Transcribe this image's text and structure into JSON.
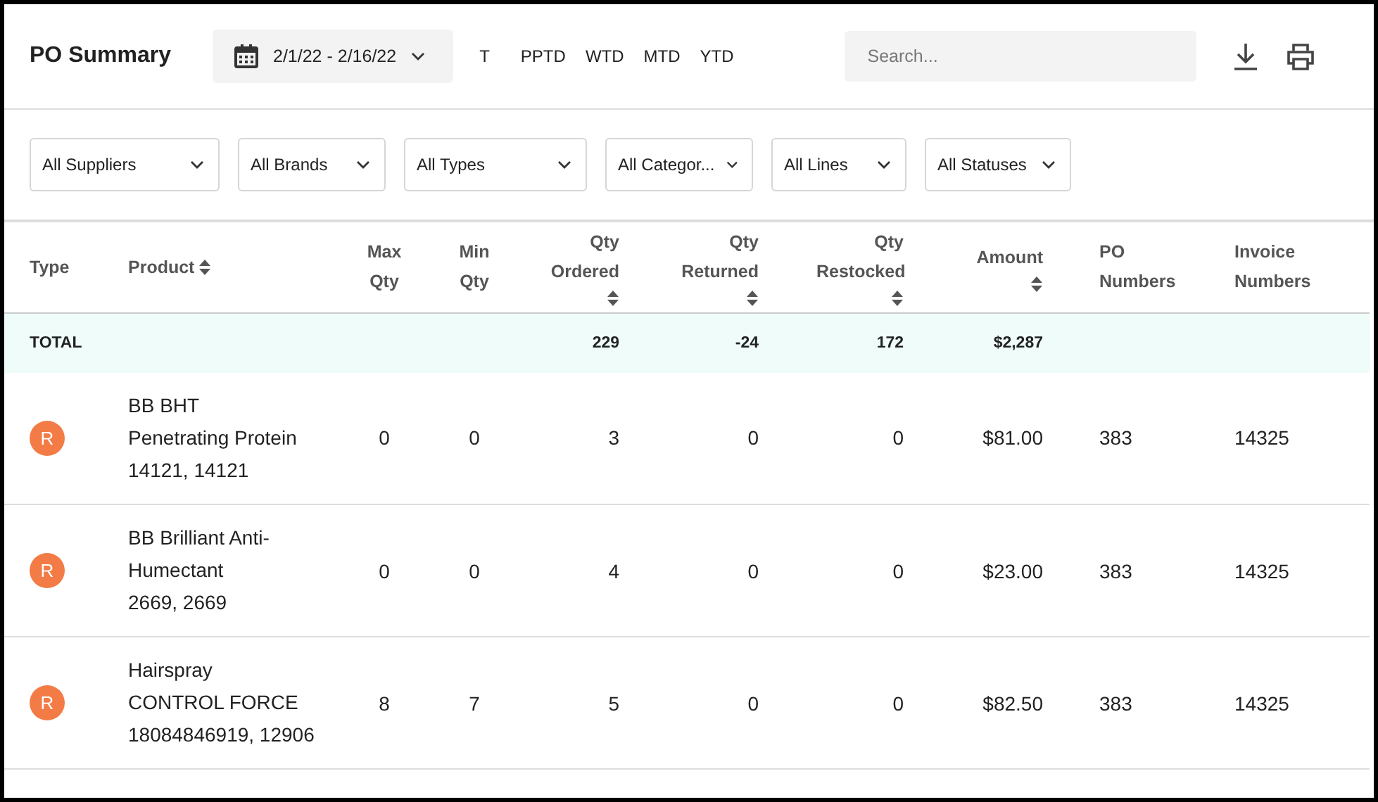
{
  "title": "PO Summary",
  "date_range": "2/1/22 - 2/16/22",
  "period_tabs": [
    "T",
    "PPTD",
    "WTD",
    "MTD",
    "YTD"
  ],
  "search": {
    "placeholder": "Search..."
  },
  "filters": [
    "All Suppliers",
    "All Brands",
    "All Types",
    "All Categor...",
    "All Lines",
    "All Statuses"
  ],
  "table": {
    "columns": [
      {
        "label": "Type",
        "sortable": false
      },
      {
        "label": "Product",
        "sortable": true
      },
      {
        "label": "Max Qty",
        "sortable": false
      },
      {
        "label": "Min Qty",
        "sortable": false
      },
      {
        "label": "Qty Ordered",
        "sortable": true
      },
      {
        "label": "Qty Returned",
        "sortable": true
      },
      {
        "label": "Qty Restocked",
        "sortable": true
      },
      {
        "label": "Amount",
        "sortable": true
      },
      {
        "label": "PO Numbers",
        "sortable": false
      },
      {
        "label": "Invoice Numbers",
        "sortable": false
      }
    ],
    "total": {
      "label": "TOTAL",
      "qty_ordered": "229",
      "qty_returned": "-24",
      "qty_restocked": "172",
      "amount": "$2,287"
    },
    "rows": [
      {
        "type": "R",
        "product": "BB BHT Penetrating Protein",
        "codes": "14121, 14121",
        "max_qty": "0",
        "min_qty": "0",
        "qty_ordered": "3",
        "qty_returned": "0",
        "qty_restocked": "0",
        "amount": "$81.00",
        "po_numbers": "383",
        "invoice_numbers": "14325"
      },
      {
        "type": "R",
        "product": "BB Brilliant Anti-Humectant",
        "codes": "2669, 2669",
        "max_qty": "0",
        "min_qty": "0",
        "qty_ordered": "4",
        "qty_returned": "0",
        "qty_restocked": "0",
        "amount": "$23.00",
        "po_numbers": "383",
        "invoice_numbers": "14325"
      },
      {
        "type": "R",
        "product": "Hairspray CONTROL FORCE",
        "codes": "18084846919, 12906",
        "max_qty": "8",
        "min_qty": "7",
        "qty_ordered": "5",
        "qty_returned": "0",
        "qty_restocked": "0",
        "amount": "$82.50",
        "po_numbers": "383",
        "invoice_numbers": "14325"
      }
    ]
  }
}
